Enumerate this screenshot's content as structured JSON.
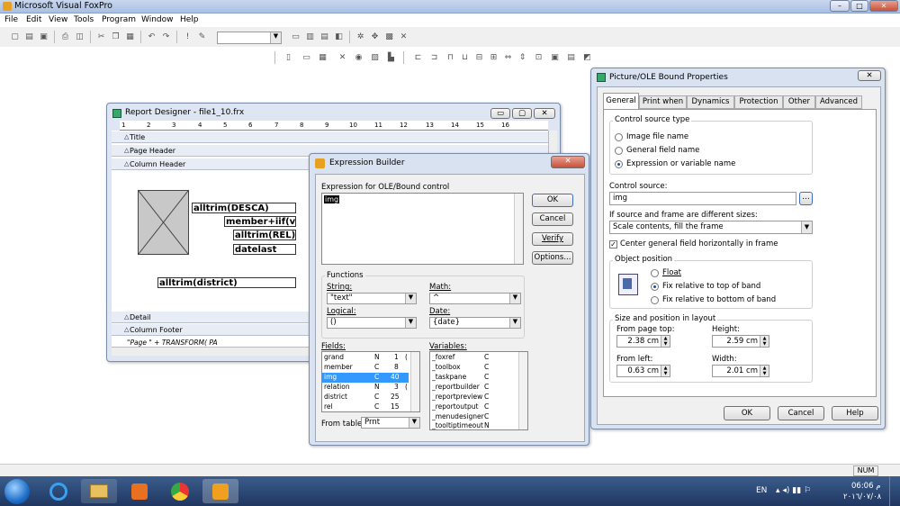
{
  "app": {
    "title": "Microsoft Visual FoxPro",
    "menu": [
      "File",
      "Edit",
      "View",
      "Tools",
      "Program",
      "Window",
      "Help"
    ]
  },
  "report": {
    "title": "Report Designer - file1_10.frx",
    "ruler": [
      "1",
      "2",
      "3",
      "4",
      "5",
      "6",
      "7",
      "8",
      "9",
      "10",
      "11",
      "12",
      "13",
      "14",
      "15",
      "16"
    ],
    "bands": {
      "title": "Title",
      "page_header": "Page Header",
      "column_header": "Column Header",
      "detail": "Detail",
      "column_footer": "Column Footer"
    },
    "fields": [
      "alltrim(DESCA)",
      "member+iif(va",
      "alltrim(REL)",
      "datelast",
      "alltrim(district)"
    ],
    "footer_text": "\"Page \" + TRANSFORM( PA"
  },
  "expr": {
    "title": "Expression Builder",
    "label": "Expression for OLE/Bound control",
    "value": "img",
    "ok": "OK",
    "cancel": "Cancel",
    "verify": "Verify",
    "options": "Options...",
    "functions": "Functions",
    "string": "String:",
    "string_val": "\"text\"",
    "math": "Math:",
    "math_val": "^",
    "logical": "Logical:",
    "logical_val": "()",
    "date": "Date:",
    "date_val": "{date}",
    "fields_label": "Fields:",
    "variables_label": "Variables:",
    "fields": [
      [
        "grand",
        "N",
        "1",
        "("
      ],
      [
        "member",
        "C",
        "8",
        ""
      ],
      [
        "img",
        "C",
        "40",
        ""
      ],
      [
        "relation",
        "N",
        "3",
        "("
      ],
      [
        "district",
        "C",
        "25",
        ""
      ],
      [
        "rel",
        "C",
        "15",
        ""
      ]
    ],
    "variables": [
      [
        "_foxref",
        "C"
      ],
      [
        "_toolbox",
        "C"
      ],
      [
        "_taskpane",
        "C"
      ],
      [
        "_reportbuilder",
        "C"
      ],
      [
        "_reportpreview",
        "C"
      ],
      [
        "_reportoutput",
        "C"
      ],
      [
        "_menudesigner",
        "C"
      ],
      [
        "_tooltiptimeout",
        "N"
      ]
    ],
    "from_table": "From table:",
    "from_table_val": "Prnt"
  },
  "props": {
    "title": "Picture/OLE Bound Properties",
    "tabs": [
      "General",
      "Print when",
      "Dynamics",
      "Protection",
      "Other",
      "Advanced"
    ],
    "control_source_type": "Control source type",
    "opt_image": "Image file name",
    "opt_general": "General field name",
    "opt_expr": "Expression or variable name",
    "control_source": "Control source:",
    "control_source_val": "img",
    "frame_label": "If source and frame are different sizes:",
    "frame_val": "Scale contents, fill the frame",
    "center": "Center general field horizontally in frame",
    "object_position": "Object position",
    "pos_float": "Float",
    "pos_top": "Fix relative to top of band",
    "pos_bottom": "Fix relative to bottom of band",
    "size_label": "Size and position in layout",
    "from_top": "From page top:",
    "from_top_val": "2.38 cm",
    "height": "Height:",
    "height_val": "2.59 cm",
    "from_left": "From left:",
    "from_left_val": "0.63 cm",
    "width": "Width:",
    "width_val": "2.01 cm",
    "ok": "OK",
    "cancel": "Cancel",
    "help": "Help"
  },
  "status": {
    "num": "NUM"
  },
  "tray": {
    "lang": "EN",
    "time": "06:06 م",
    "date": "٢٠١٦/٠٧/٠٨"
  }
}
